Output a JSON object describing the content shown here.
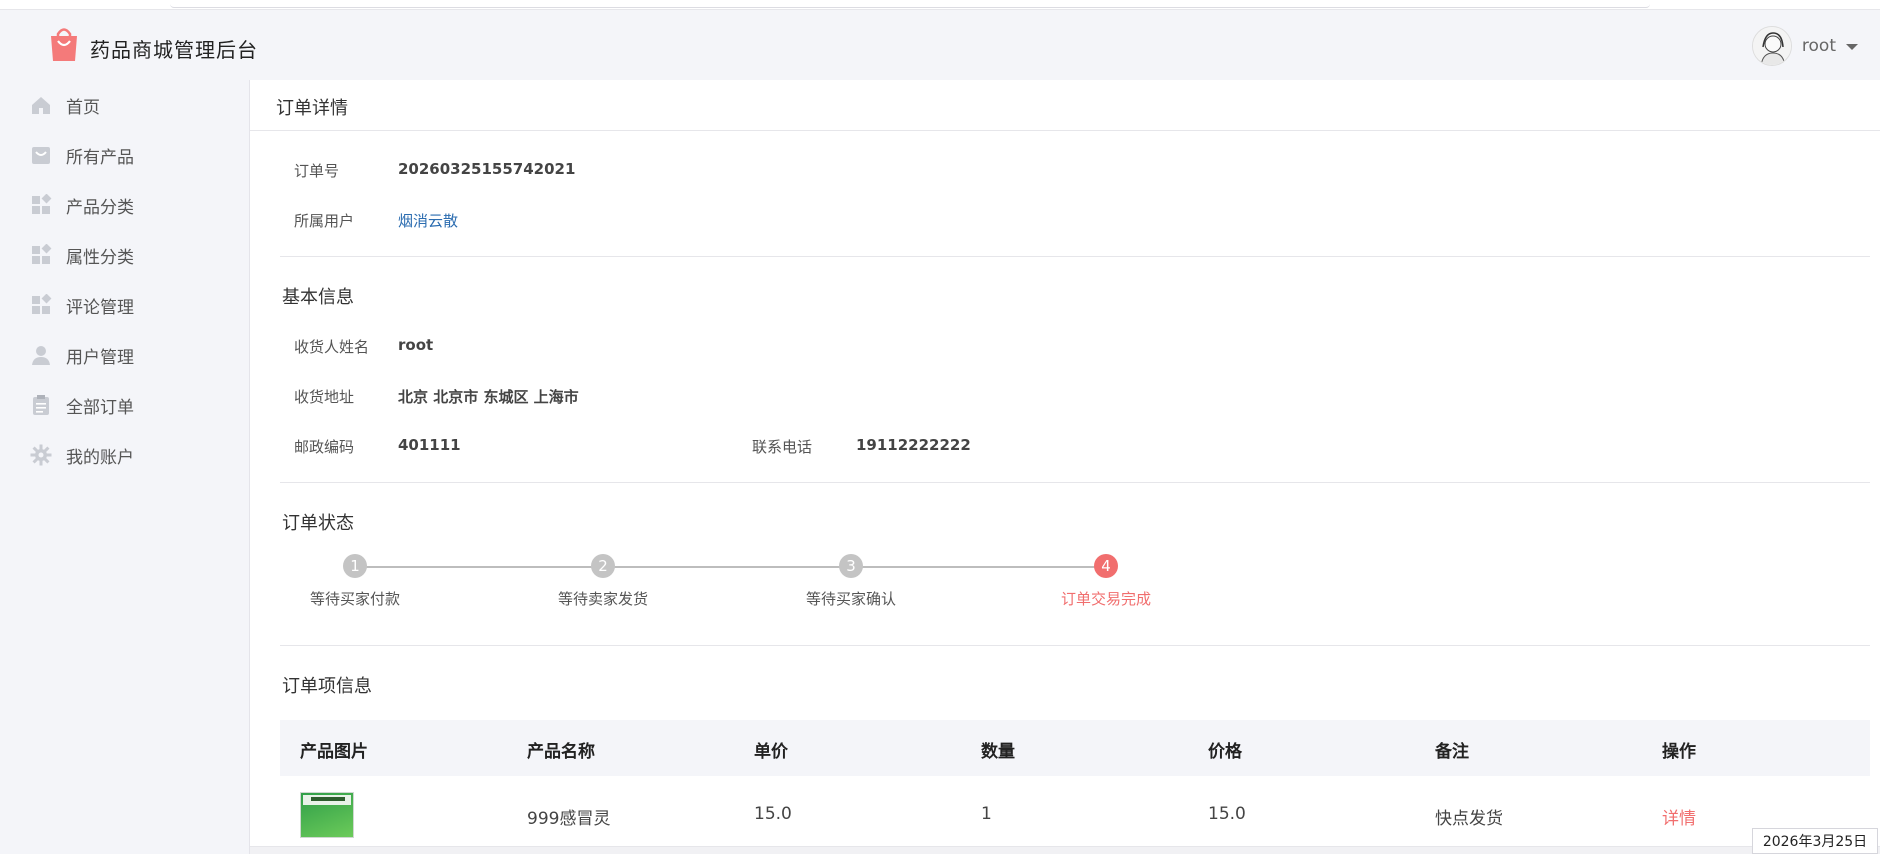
{
  "app": {
    "brand": "药品商城管理后台"
  },
  "user": {
    "name": "root"
  },
  "sidebar": {
    "items": [
      {
        "label": "首页",
        "icon": "home-icon"
      },
      {
        "label": "所有产品",
        "icon": "bag-icon"
      },
      {
        "label": "产品分类",
        "icon": "grid-icon"
      },
      {
        "label": "属性分类",
        "icon": "grid-icon"
      },
      {
        "label": "评论管理",
        "icon": "grid-icon"
      },
      {
        "label": "用户管理",
        "icon": "user-icon"
      },
      {
        "label": "全部订单",
        "icon": "clipboard-icon"
      },
      {
        "label": "我的账户",
        "icon": "gear-icon"
      }
    ]
  },
  "page": {
    "title": "订单详情"
  },
  "order": {
    "number_label": "订单号",
    "number_value": "20260325155742021",
    "owner_label": "所属用户",
    "owner_value": "烟消云散"
  },
  "basic": {
    "title": "基本信息",
    "receiver_label": "收货人姓名",
    "receiver_value": "root",
    "address_label": "收货地址",
    "address_value": "北京 北京市 东城区 上海市",
    "zip_label": "邮政编码",
    "zip_value": "401111",
    "phone_label": "联系电话",
    "phone_value": "19112222222"
  },
  "status": {
    "title": "订单状态",
    "steps": [
      {
        "num": "1",
        "label": "等待买家付款"
      },
      {
        "num": "2",
        "label": "等待卖家发货"
      },
      {
        "num": "3",
        "label": "等待买家确认"
      },
      {
        "num": "4",
        "label": "订单交易完成"
      }
    ],
    "active_step": 4
  },
  "items": {
    "title": "订单项信息",
    "columns": [
      "产品图片",
      "产品名称",
      "单价",
      "数量",
      "价格",
      "备注",
      "操作"
    ],
    "rows": [
      {
        "name": "999感冒灵",
        "unit_price": "15.0",
        "qty": "1",
        "price": "15.0",
        "note": "快点发货",
        "action": "详情"
      }
    ]
  },
  "footer": {
    "date": "2026年3月25日"
  },
  "colors": {
    "accent": "#f16e6e",
    "link": "#2b6cb0",
    "step_inactive": "#c4c4c4"
  }
}
